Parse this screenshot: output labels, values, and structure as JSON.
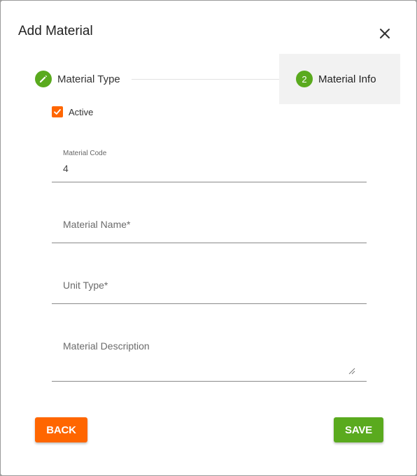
{
  "dialog": {
    "title": "Add Material",
    "close_icon": "close-icon"
  },
  "stepper": {
    "steps": [
      {
        "label": "Material Type",
        "icon": "pencil-icon",
        "state": "completed"
      },
      {
        "label": "Material Info",
        "number": "2",
        "state": "active"
      }
    ]
  },
  "form": {
    "active_label": "Active",
    "active_checked": true,
    "material_code": {
      "label": "Material Code",
      "value": "4"
    },
    "material_name": {
      "placeholder": "Material Name*"
    },
    "unit_type": {
      "placeholder": "Unit Type*"
    },
    "material_description": {
      "placeholder": "Material Description"
    }
  },
  "actions": {
    "back_label": "BACK",
    "save_label": "SAVE"
  },
  "colors": {
    "accent_orange": "#ff6600",
    "accent_green": "#5aaa1e",
    "active_step_bg": "#f2f2f2"
  }
}
